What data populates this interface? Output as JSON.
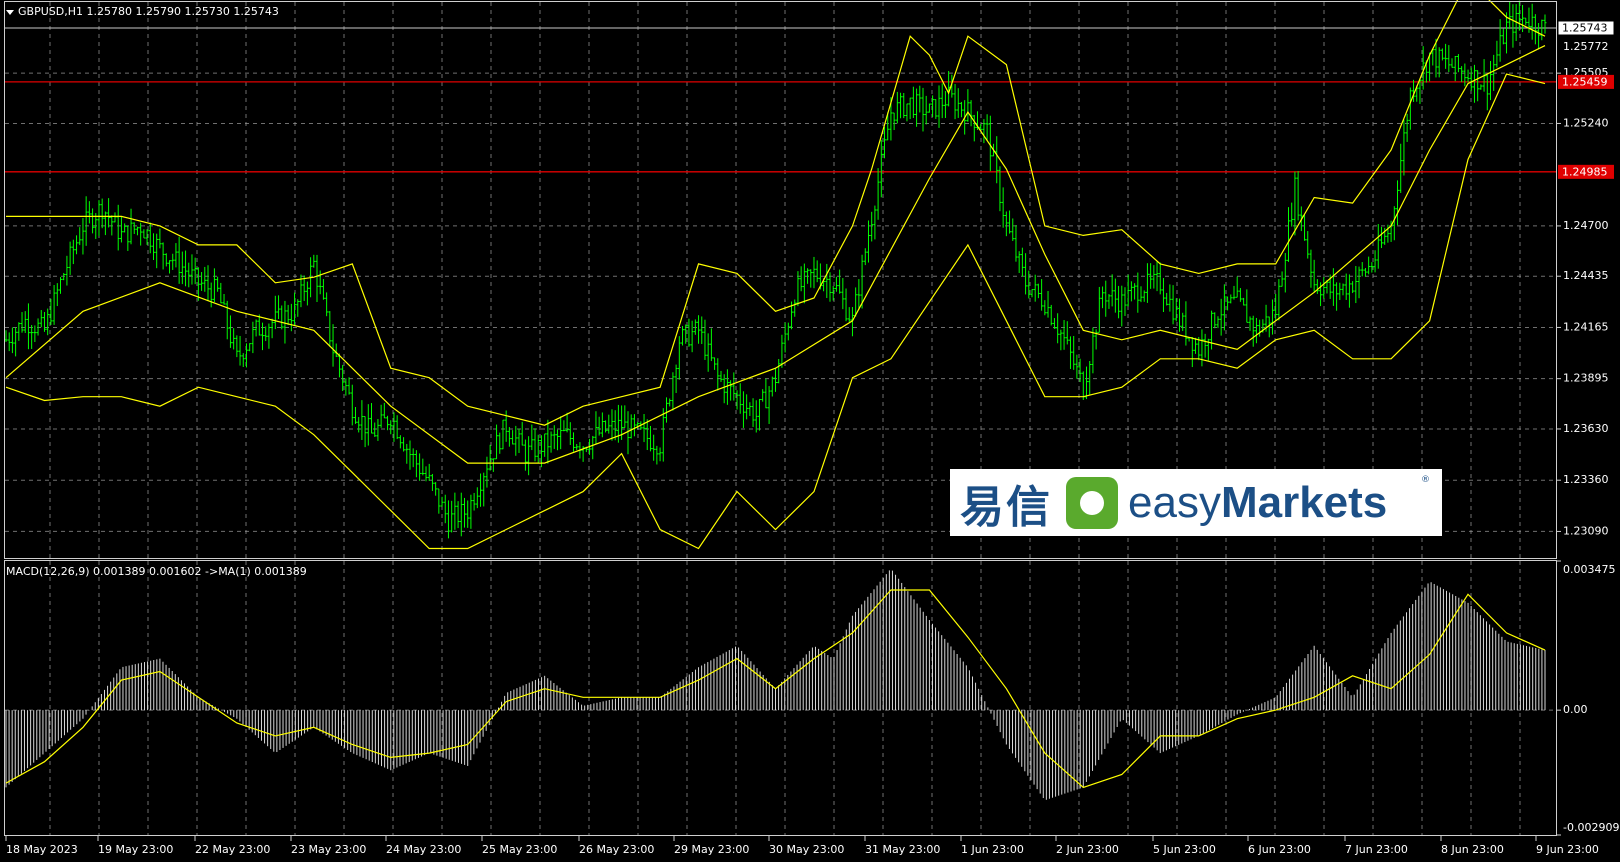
{
  "header": {
    "price_title": "GBPUSD,H1  1.25780 1.25790 1.25730 1.25743",
    "macd_title": "MACD(12,26,9) 0.001389 0.001602  ->MA(1) 0.001389"
  },
  "logo": {
    "cn": "易信",
    "brand_light": "easy",
    "brand_bold": "Markets",
    "reg": "®"
  },
  "colors": {
    "background": "#000000",
    "grid": "#a0a0a0",
    "candle": "#00ff00",
    "band": "#ffff00",
    "hline": "#e00000",
    "macd_hist": "#ffffff",
    "signal": "#ffff00"
  },
  "chart_data": [
    {
      "type": "candlestick",
      "title": "GBPUSD,H1",
      "ylim": [
        1.2295,
        1.2588
      ],
      "y_ticks": [
        "1.25505",
        "1.25240",
        "1.24700",
        "1.24435",
        "1.24165",
        "1.23895",
        "1.23630",
        "1.23360",
        "1.23090"
      ],
      "x_ticks": [
        "18 May 2023",
        "19 May 23:00",
        "22 May 23:00",
        "23 May 23:00",
        "24 May 23:00",
        "25 May 23:00",
        "26 May 23:00",
        "29 May 23:00",
        "30 May 23:00",
        "31 May 23:00",
        "1 Jun 23:00",
        "2 Jun 23:00",
        "5 Jun 23:00",
        "6 Jun 23:00",
        "7 Jun 23:00",
        "8 Jun 23:00",
        "9 Jun 23:00"
      ],
      "current_price": {
        "label": "1.25743",
        "value": 1.25743
      },
      "partial_tick_label": "1.25772",
      "hlines": [
        {
          "label": "1.25459",
          "value": 1.25459
        },
        {
          "label": "1.24985",
          "value": 1.24985
        }
      ],
      "price_path": {
        "x": [
          0,
          2,
          4,
          6,
          8,
          10,
          12,
          14,
          16,
          18,
          20,
          22,
          24,
          26,
          28,
          30,
          32,
          34,
          36,
          38,
          40,
          42,
          44,
          46,
          48,
          50,
          52,
          54,
          56,
          58,
          60,
          62,
          64,
          66,
          68,
          70,
          72,
          74,
          76,
          78,
          80,
          82,
          84,
          86,
          88,
          90,
          92,
          94,
          96,
          98,
          100,
          102,
          104,
          106,
          108,
          110,
          112,
          114,
          116,
          118,
          120,
          122,
          124,
          126,
          128,
          130,
          132,
          134,
          136,
          138,
          140,
          142,
          144,
          146,
          148,
          150,
          152,
          154,
          156,
          158,
          160
        ],
        "y": [
          1.241,
          1.242,
          1.2415,
          1.2445,
          1.247,
          1.248,
          1.2465,
          1.247,
          1.2458,
          1.245,
          1.244,
          1.2435,
          1.24,
          1.2415,
          1.242,
          1.2425,
          1.245,
          1.2405,
          1.2375,
          1.236,
          1.237,
          1.235,
          1.2335,
          1.2315,
          1.232,
          1.2345,
          1.2365,
          1.235,
          1.2355,
          1.236,
          1.2355,
          1.2362,
          1.2365,
          1.236,
          1.2355,
          1.241,
          1.2415,
          1.239,
          1.238,
          1.237,
          1.239,
          1.2435,
          1.2445,
          1.244,
          1.242,
          1.2475,
          1.253,
          1.2535,
          1.253,
          1.2538,
          1.253,
          1.252,
          1.247,
          1.244,
          1.243,
          1.241,
          1.2385,
          1.2435,
          1.243,
          1.2438,
          1.244,
          1.242,
          1.2405,
          1.2425,
          1.243,
          1.2415,
          1.2425,
          1.249,
          1.244,
          1.2435,
          1.244,
          1.245,
          1.247,
          1.254,
          1.256,
          1.2555,
          1.255,
          1.2545,
          1.2575,
          1.258,
          1.2574
        ]
      },
      "band_upper": {
        "x": [
          0,
          4,
          8,
          12,
          16,
          20,
          24,
          28,
          32,
          36,
          40,
          44,
          48,
          52,
          56,
          60,
          64,
          68,
          72,
          76,
          80,
          84,
          88,
          90,
          94,
          96,
          98,
          100,
          104,
          108,
          112,
          116,
          120,
          124,
          128,
          132,
          136,
          140,
          144,
          148,
          152,
          156,
          160
        ],
        "y": [
          1.2475,
          1.2475,
          1.2475,
          1.2475,
          1.247,
          1.246,
          1.246,
          1.244,
          1.2443,
          1.245,
          1.2395,
          1.239,
          1.2375,
          1.237,
          1.2365,
          1.2375,
          1.238,
          1.2385,
          1.245,
          1.2445,
          1.2425,
          1.2432,
          1.247,
          1.25,
          1.257,
          1.256,
          1.254,
          1.257,
          1.2555,
          1.247,
          1.2465,
          1.2468,
          1.245,
          1.2445,
          1.245,
          1.245,
          1.2485,
          1.2482,
          1.251,
          1.256,
          1.26,
          1.258,
          1.257
        ]
      },
      "band_mid": {
        "x": [
          0,
          8,
          16,
          24,
          32,
          40,
          48,
          56,
          64,
          72,
          80,
          88,
          96,
          100,
          104,
          108,
          112,
          116,
          120,
          128,
          136,
          144,
          148,
          152,
          156,
          160
        ],
        "y": [
          1.239,
          1.2425,
          1.244,
          1.2425,
          1.2415,
          1.2375,
          1.2345,
          1.2345,
          1.236,
          1.238,
          1.2395,
          1.242,
          1.2495,
          1.253,
          1.25,
          1.2455,
          1.2415,
          1.241,
          1.2415,
          1.2405,
          1.2435,
          1.247,
          1.251,
          1.2545,
          1.2555,
          1.2565
        ]
      },
      "band_lower": {
        "x": [
          0,
          4,
          8,
          12,
          16,
          20,
          24,
          28,
          32,
          36,
          40,
          44,
          48,
          52,
          56,
          60,
          64,
          68,
          72,
          76,
          80,
          84,
          88,
          92,
          96,
          100,
          104,
          108,
          112,
          116,
          120,
          124,
          128,
          132,
          136,
          140,
          144,
          148,
          152,
          156,
          160
        ],
        "y": [
          1.2385,
          1.2378,
          1.238,
          1.238,
          1.2375,
          1.2385,
          1.238,
          1.2375,
          1.236,
          1.234,
          1.232,
          1.23,
          1.23,
          1.231,
          1.232,
          1.233,
          1.235,
          1.231,
          1.23,
          1.233,
          1.231,
          1.233,
          1.239,
          1.24,
          1.243,
          1.246,
          1.242,
          1.238,
          1.238,
          1.2385,
          1.24,
          1.24,
          1.2395,
          1.241,
          1.2415,
          1.24,
          1.24,
          1.242,
          1.2505,
          1.255,
          1.2545
        ]
      }
    },
    {
      "type": "histogram",
      "title": "MACD(12,26,9)",
      "ylim": [
        -0.002909,
        0.003475
      ],
      "y_ticks": [
        "0.003475",
        "0.00",
        "-0.002909"
      ],
      "histogram": {
        "x": [
          0,
          4,
          8,
          12,
          16,
          20,
          24,
          28,
          32,
          36,
          40,
          44,
          48,
          52,
          56,
          60,
          64,
          68,
          72,
          76,
          80,
          84,
          86,
          88,
          92,
          96,
          100,
          104,
          108,
          112,
          116,
          120,
          124,
          128,
          132,
          136,
          140,
          144,
          148,
          152,
          156,
          160
        ],
        "y": [
          -0.0018,
          -0.001,
          -0.0002,
          0.001,
          0.0012,
          0.0003,
          -0.0002,
          -0.001,
          -0.0004,
          -0.001,
          -0.0014,
          -0.001,
          -0.0013,
          0.0004,
          0.0008,
          0.0001,
          0.0003,
          0.0003,
          0.001,
          0.0015,
          0.0005,
          0.0015,
          0.0012,
          0.0022,
          0.0033,
          0.0021,
          0.001,
          -0.0008,
          -0.0021,
          -0.0018,
          -0.0002,
          -0.001,
          -0.0006,
          -0.0001,
          0.0003,
          0.0015,
          0.0003,
          0.0018,
          0.003,
          0.0025,
          0.0016,
          0.0014
        ]
      },
      "signal": {
        "x": [
          0,
          4,
          8,
          12,
          16,
          20,
          24,
          28,
          32,
          36,
          40,
          44,
          48,
          52,
          56,
          60,
          64,
          68,
          72,
          76,
          80,
          84,
          88,
          92,
          96,
          100,
          104,
          108,
          112,
          116,
          120,
          124,
          128,
          132,
          136,
          140,
          144,
          148,
          152,
          156,
          160
        ],
        "y": [
          -0.0017,
          -0.0012,
          -0.0004,
          0.0007,
          0.0009,
          0.0003,
          -0.0003,
          -0.0006,
          -0.0004,
          -0.0008,
          -0.0011,
          -0.001,
          -0.0008,
          0.0002,
          0.0005,
          0.0003,
          0.0003,
          0.0003,
          0.0007,
          0.0012,
          0.0005,
          0.0012,
          0.0018,
          0.0028,
          0.0028,
          0.0017,
          0.0005,
          -0.001,
          -0.0018,
          -0.0015,
          -0.0006,
          -0.0006,
          -0.0002,
          0.0,
          0.0003,
          0.0008,
          0.0005,
          0.0013,
          0.0027,
          0.0018,
          0.0014
        ]
      }
    }
  ]
}
